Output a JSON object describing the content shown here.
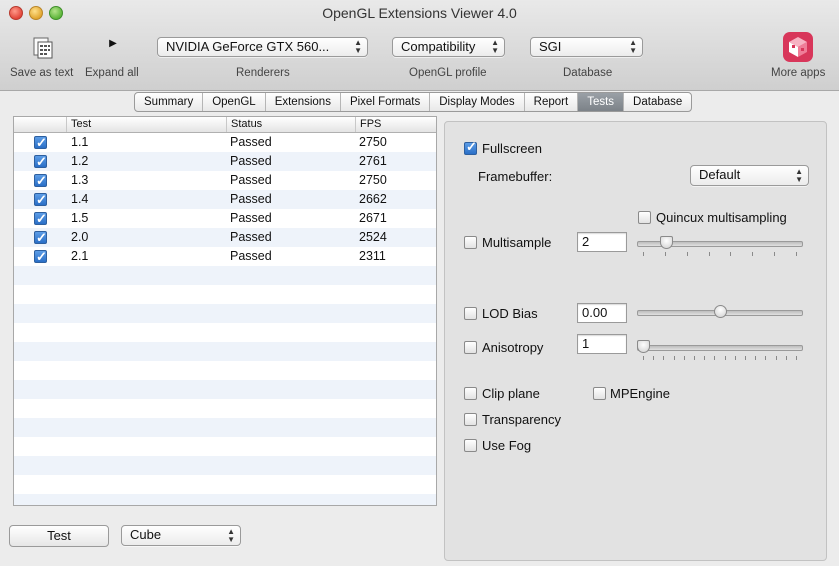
{
  "window": {
    "title": "OpenGL Extensions Viewer 4.0"
  },
  "toolbar": {
    "save_label": "Save as text",
    "expand_label": "Expand all",
    "renderer_value": "NVIDIA GeForce GTX 560...",
    "renderers_label": "Renderers",
    "profile_value": "Compatibility",
    "profile_label": "OpenGL profile",
    "database_value": "SGI",
    "database_label": "Database",
    "more_apps_label": "More apps",
    "icons": {
      "save": "save-text-icon",
      "expand": "disclosure-triangle-icon",
      "more_apps": "app-store-cube-icon"
    }
  },
  "tabs": [
    "Summary",
    "OpenGL",
    "Extensions",
    "Pixel Formats",
    "Display Modes",
    "Report",
    "Tests",
    "Database"
  ],
  "active_tab": "Tests",
  "tests_table": {
    "columns": [
      "Test",
      "Status",
      "FPS"
    ],
    "rows": [
      {
        "test": "1.1",
        "status": "Passed",
        "fps": "2750",
        "checked": true
      },
      {
        "test": "1.2",
        "status": "Passed",
        "fps": "2761",
        "checked": true
      },
      {
        "test": "1.3",
        "status": "Passed",
        "fps": "2750",
        "checked": true
      },
      {
        "test": "1.4",
        "status": "Passed",
        "fps": "2662",
        "checked": true
      },
      {
        "test": "1.5",
        "status": "Passed",
        "fps": "2671",
        "checked": true
      },
      {
        "test": "2.0",
        "status": "Passed",
        "fps": "2524",
        "checked": true
      },
      {
        "test": "2.1",
        "status": "Passed",
        "fps": "2311",
        "checked": true
      }
    ]
  },
  "bottom": {
    "test_button": "Test",
    "shape_value": "Cube"
  },
  "options": {
    "fullscreen_label": "Fullscreen",
    "fullscreen_checked": true,
    "framebuffer_label": "Framebuffer:",
    "framebuffer_value": "Default",
    "quincux_label": "Quincux multisampling",
    "multisample_label": "Multisample",
    "multisample_value": "2",
    "multisample_level": 0.15,
    "lod_label": "LOD Bias",
    "lod_value": "0.00",
    "lod_level": 0.5,
    "aniso_label": "Anisotropy",
    "aniso_value": "1",
    "aniso_level": 0.0,
    "clip_label": "Clip plane",
    "mpengine_label": "MPEngine",
    "transparency_label": "Transparency",
    "fog_label": "Use Fog"
  },
  "colors": {
    "accent": "#2a6fc7",
    "active_tab": "#8a9096",
    "row_alt": "#eef3fa"
  }
}
